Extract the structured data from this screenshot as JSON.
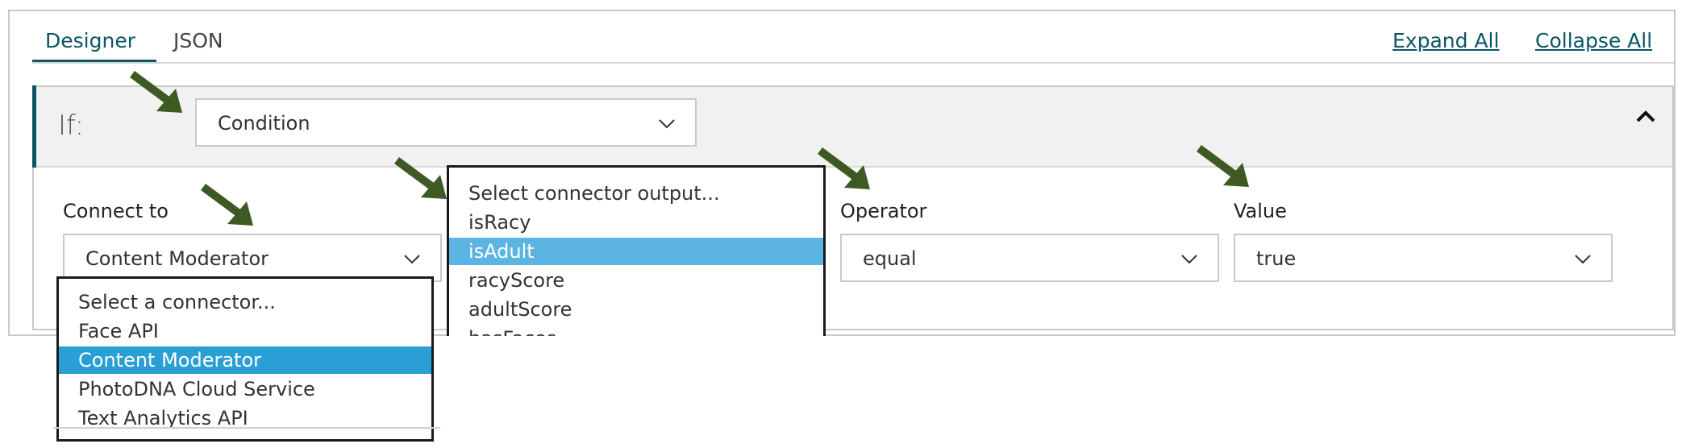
{
  "tabs": [
    {
      "label": "Designer",
      "active": true
    },
    {
      "label": "JSON",
      "active": false
    }
  ],
  "header_links": {
    "expand_all": "Expand All",
    "collapse_all": "Collapse All"
  },
  "condition": {
    "if_label": "If:",
    "type_value": "Condition"
  },
  "fields": {
    "connect_to": {
      "label": "Connect to",
      "value": "Content Moderator"
    },
    "operator": {
      "label": "Operator",
      "value": "equal"
    },
    "value": {
      "label": "Value",
      "value": "true"
    }
  },
  "connector_dropdown": {
    "options": [
      "Select a connector...",
      "Face API",
      "Content Moderator",
      "PhotoDNA Cloud Service",
      "Text Analytics API"
    ],
    "selected_index": 2
  },
  "output_dropdown": {
    "options": [
      "Select connector output...",
      "isRacy",
      "isAdult",
      "racyScore",
      "adultScore",
      "hasFaces"
    ],
    "selected_index": 2
  },
  "icons": {
    "chevron": "chevron-down-icon",
    "collapse": "chevron-up-icon",
    "annotation": "arrow-annotation-icon"
  },
  "colors": {
    "accent": "#0b5565",
    "connector_selected": "#2a9fd6",
    "output_selected": "#5cb4e3",
    "arrow": "#3d5a23"
  }
}
